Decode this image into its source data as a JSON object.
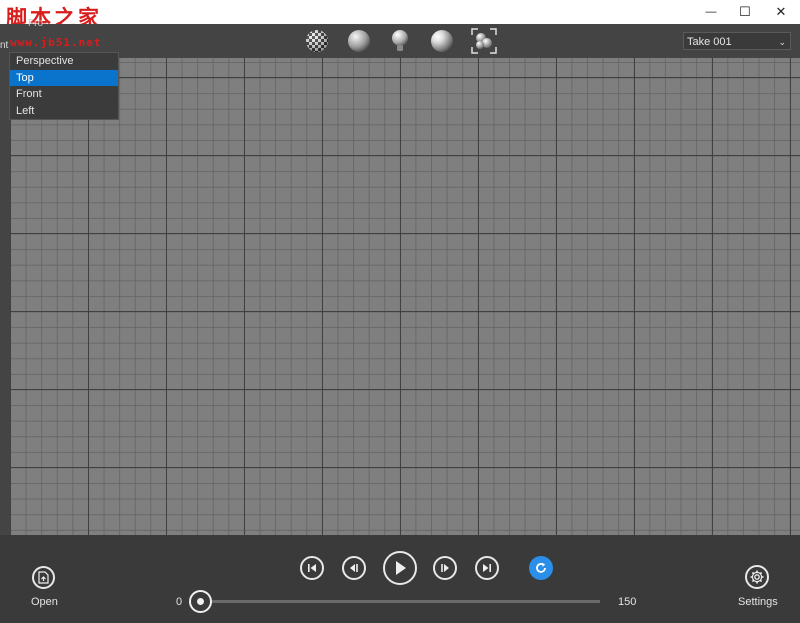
{
  "window": {
    "watermark": "脚本之家",
    "watermark_url": "www.jb51.net",
    "minimize_glyph": "—",
    "maximize_glyph": "☐",
    "close_glyph": "✕"
  },
  "toolbar": {
    "camera_trigger_label": "Fro",
    "camera_left_stub": "nt",
    "camera_options": [
      "Perspective",
      "Top",
      "Front",
      "Left"
    ],
    "camera_selected": "Top",
    "take_value": "Take 001",
    "take_chevron": "⌄",
    "icons": [
      "checker-material-icon",
      "sphere-shaded-icon",
      "light-bulb-icon",
      "sphere-glossy-icon",
      "fit-view-icon"
    ]
  },
  "playback": {
    "open_label": "Open",
    "settings_label": "Settings",
    "slider_min": "0",
    "slider_max": "150",
    "slider_value": 0,
    "loop_color": "#2b8ee8"
  }
}
